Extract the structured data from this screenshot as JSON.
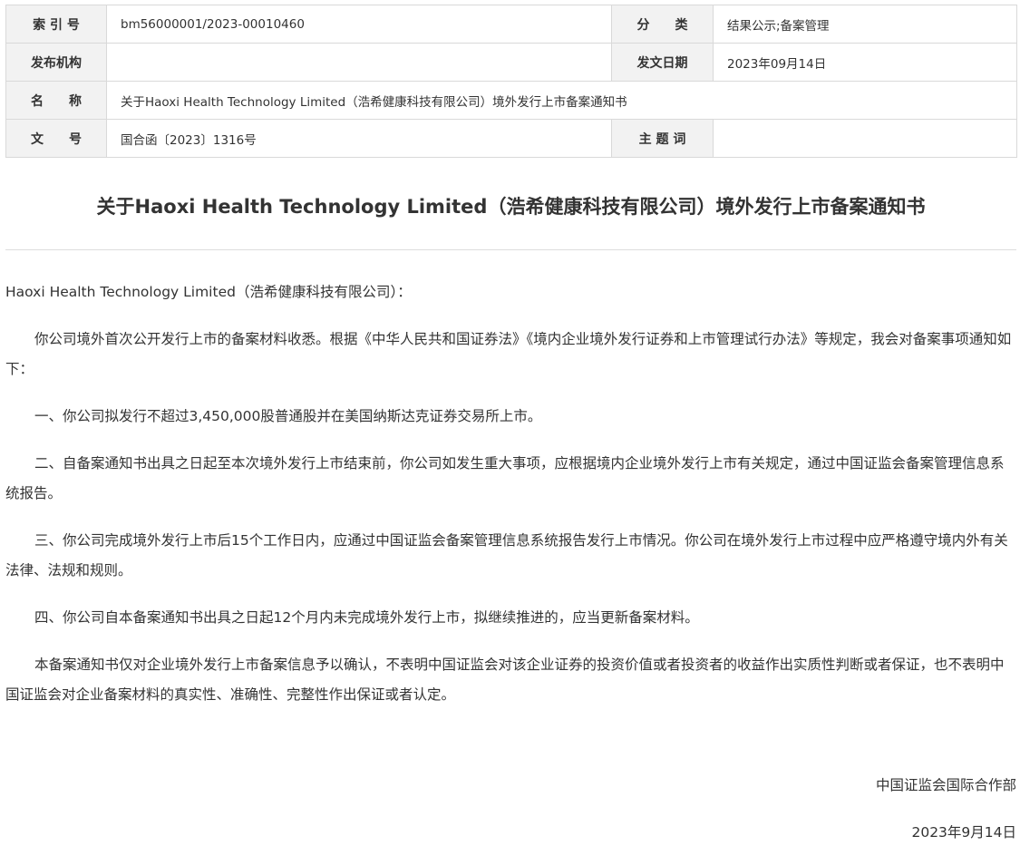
{
  "meta": {
    "index_label": "索 引 号",
    "index_value": "bm56000001/2023-00010460",
    "category_label": "分　　类",
    "category_value": "结果公示;备案管理",
    "issuer_label": "发布机构",
    "issuer_value": "",
    "date_label": "发文日期",
    "date_value": "2023年09月14日",
    "name_label": "名　　称",
    "name_value": "关于Haoxi Health Technology Limited（浩希健康科技有限公司）境外发行上市备案通知书",
    "docno_label": "文　　号",
    "docno_value": "国合函〔2023〕1316号",
    "keywords_label": "主 题 词",
    "keywords_value": ""
  },
  "document": {
    "title": "关于Haoxi Health Technology Limited（浩希健康科技有限公司）境外发行上市备案通知书",
    "salutation": "Haoxi Health Technology Limited（浩希健康科技有限公司）：",
    "paragraphs": [
      "你公司境外首次公开发行上市的备案材料收悉。根据《中华人民共和国证券法》《境内企业境外发行证券和上市管理试行办法》等规定，我会对备案事项通知如下：",
      "一、你公司拟发行不超过3,450,000股普通股并在美国纳斯达克证券交易所上市。",
      "二、自备案通知书出具之日起至本次境外发行上市结束前，你公司如发生重大事项，应根据境内企业境外发行上市有关规定，通过中国证监会备案管理信息系统报告。",
      "三、你公司完成境外发行上市后15个工作日内，应通过中国证监会备案管理信息系统报告发行上市情况。你公司在境外发行上市过程中应严格遵守境内外有关法律、法规和规则。",
      "四、你公司自本备案通知书出具之日起12个月内未完成境外发行上市，拟继续推进的，应当更新备案材料。",
      "本备案通知书仅对企业境外发行上市备案信息予以确认，不表明中国证监会对该企业证券的投资价值或者投资者的收益作出实质性判断或者保证，也不表明中国证监会对企业备案材料的真实性、准确性、完整性作出保证或者认定。"
    ],
    "signature_org": "中国证监会国际合作部",
    "signature_date": "2023年9月14日"
  }
}
